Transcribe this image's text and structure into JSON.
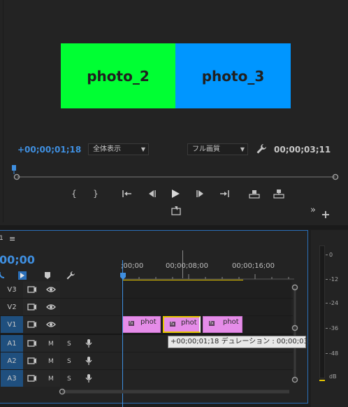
{
  "monitor": {
    "clip_a_label": "photo_2",
    "clip_b_label": "photo_3",
    "clip_a_color": "#00ff33",
    "clip_b_color": "#0096ff",
    "timecode_current": "+00;00;01;18",
    "timecode_duration": "00;00;03;11",
    "zoom_dropdown": "全体表示",
    "quality_dropdown": "フル画質",
    "transport_buttons": [
      "mark-in",
      "mark-out",
      "go-to-in",
      "step-back",
      "play",
      "step-forward",
      "go-to-out",
      "lift",
      "extract",
      "export-frame",
      "more",
      "add"
    ]
  },
  "timeline": {
    "sequence_number": "1",
    "timecode": "00;00",
    "ruler_labels": [
      ";00;00",
      "00;00;08;00",
      "00;00;16;00"
    ],
    "tracks": [
      {
        "name": "V3",
        "type": "video",
        "target": false
      },
      {
        "name": "V2",
        "type": "video",
        "target": false
      },
      {
        "name": "V1",
        "type": "video",
        "target": true
      },
      {
        "name": "A1",
        "type": "audio",
        "target": true,
        "m": "M",
        "s": "S"
      },
      {
        "name": "A2",
        "type": "audio",
        "target": true,
        "m": "M",
        "s": "S"
      },
      {
        "name": "A3",
        "type": "audio",
        "target": true,
        "m": "M",
        "s": "S"
      }
    ],
    "clips": [
      {
        "name": "phot",
        "fx": "fx"
      },
      {
        "name": "phot",
        "fx": "fx"
      },
      {
        "name": "phot",
        "fx": "fx"
      }
    ],
    "tooltip": "+00;00;01;18 デュレーション : 00;00;03;11"
  },
  "meter": {
    "labels": [
      "0",
      "-12",
      "-24",
      "-36",
      "-48",
      "dB"
    ]
  },
  "colors": {
    "accent": "#3f8fe0",
    "clip": "#e58ce8",
    "work_area": "#e6c600"
  }
}
